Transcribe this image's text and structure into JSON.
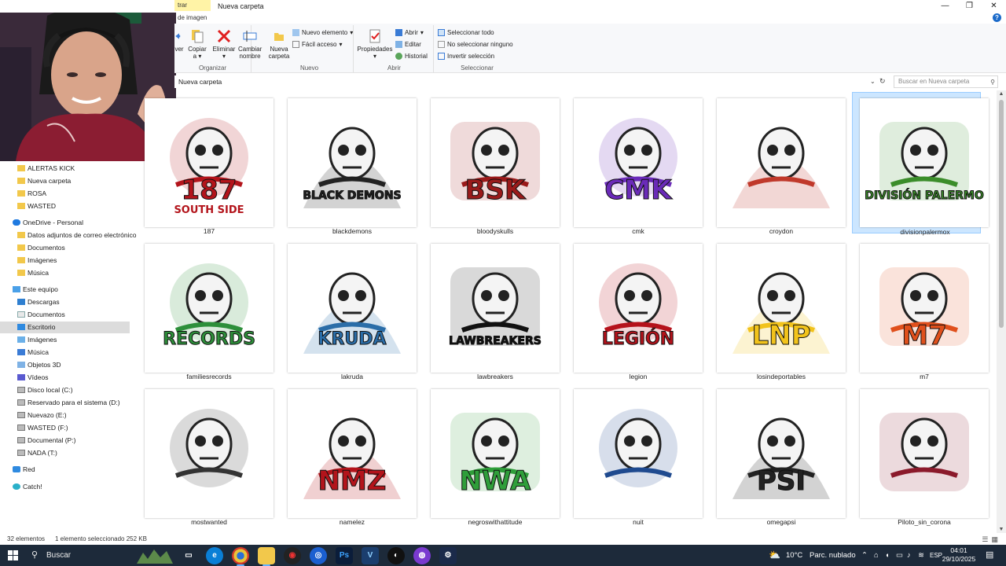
{
  "window": {
    "title_tab": "trar",
    "title": "Nueva carpeta",
    "minimize": "—",
    "maximize": "❐",
    "close": "✕"
  },
  "ribbon": {
    "tab_partial": "de imagen",
    "partial_btn": "ver",
    "copy": "Copiar",
    "delete": "Eliminar",
    "rename": "Cambiar nombre",
    "new_folder": "Nueva carpeta",
    "new_item": "Nuevo elemento",
    "easy_access": "Fácil acceso",
    "properties": "Propiedades",
    "open": "Abrir",
    "edit": "Editar",
    "history": "Historial",
    "select_all": "Seleccionar todo",
    "select_none": "No seleccionar ninguno",
    "invert": "Invertir selección",
    "group_organize": "Organizar",
    "group_new": "Nuevo",
    "group_open": "Abrir",
    "group_select": "Seleccionar"
  },
  "address": {
    "path": "Nueva carpeta",
    "search_placeholder": "Buscar en Nueva carpeta"
  },
  "sidebar": {
    "items": [
      {
        "label": "ALERTAS KICK"
      },
      {
        "label": "Nueva carpeta"
      },
      {
        "label": "ROSA"
      },
      {
        "label": "WASTED"
      },
      {
        "label": "OneDrive - Personal"
      },
      {
        "label": "Datos adjuntos de correo electrónico"
      },
      {
        "label": "Documentos"
      },
      {
        "label": "Imágenes"
      },
      {
        "label": "Música"
      },
      {
        "label": "Este equipo"
      },
      {
        "label": "Descargas"
      },
      {
        "label": "Documentos"
      },
      {
        "label": "Escritorio"
      },
      {
        "label": "Imágenes"
      },
      {
        "label": "Música"
      },
      {
        "label": "Objetos 3D"
      },
      {
        "label": "Vídeos"
      },
      {
        "label": "Disco local (C:)"
      },
      {
        "label": "Reservado para el sistema (D:)"
      },
      {
        "label": "Nuevazo (E:)"
      },
      {
        "label": "WASTED (F:)"
      },
      {
        "label": "Documental (P:)"
      },
      {
        "label": "NADA (T:)"
      },
      {
        "label": "Red"
      },
      {
        "label": "Catch!"
      }
    ]
  },
  "files": [
    {
      "name": "187",
      "art": {
        "text": "187",
        "sub": "SOUTH SIDE",
        "color": "#b3141b"
      }
    },
    {
      "name": "blackdemons",
      "art": {
        "text": "BLACK DEMONS",
        "color": "#222222"
      }
    },
    {
      "name": "bloodyskulls",
      "art": {
        "text": "BSK",
        "color": "#9a1a1a"
      }
    },
    {
      "name": "cmk",
      "art": {
        "text": "CMK",
        "color": "#6a2bb8"
      }
    },
    {
      "name": "croydon",
      "art": {
        "text": "",
        "color": "#c0392b"
      }
    },
    {
      "name": "divisionpalermox",
      "art": {
        "text": "DIVISIÓN PALERMO",
        "color": "#3b8d2a"
      }
    },
    {
      "name": "familiesrecords",
      "art": {
        "text": "RECORDS",
        "color": "#2d8f3a"
      }
    },
    {
      "name": "lakruda",
      "art": {
        "text": "KRUDA",
        "color": "#2a6da8"
      }
    },
    {
      "name": "lawbreakers",
      "art": {
        "text": "LAWBREAKERS",
        "color": "#111111"
      }
    },
    {
      "name": "legion",
      "art": {
        "text": "LEGIÓN",
        "color": "#b5121b"
      }
    },
    {
      "name": "losindeportables",
      "art": {
        "text": "LNP",
        "color": "#f2c31b"
      }
    },
    {
      "name": "m7",
      "art": {
        "text": "M7",
        "color": "#e0501c"
      }
    },
    {
      "name": "mostwanted",
      "art": {
        "text": "",
        "color": "#333333"
      }
    },
    {
      "name": "namelez",
      "art": {
        "text": "NMZ",
        "color": "#b3141b"
      }
    },
    {
      "name": "negroswithattitude",
      "art": {
        "text": "NWA",
        "color": "#2f9e3a"
      }
    },
    {
      "name": "nuit",
      "art": {
        "text": "",
        "color": "#1f4a8f"
      }
    },
    {
      "name": "omegapsi",
      "art": {
        "text": "PSI",
        "color": "#222222"
      }
    },
    {
      "name": "Piloto_sin_corona",
      "art": {
        "text": "",
        "color": "#8b1a2b"
      }
    }
  ],
  "status": {
    "count": "32 elementos",
    "selected": "1 elemento seleccionado  252 KB"
  },
  "taskbar": {
    "search": "Buscar",
    "weather_temp": "10°C",
    "weather_desc": "Parc. nublado",
    "lang": "ESP",
    "time": "04:01",
    "date": "29/10/2025"
  }
}
